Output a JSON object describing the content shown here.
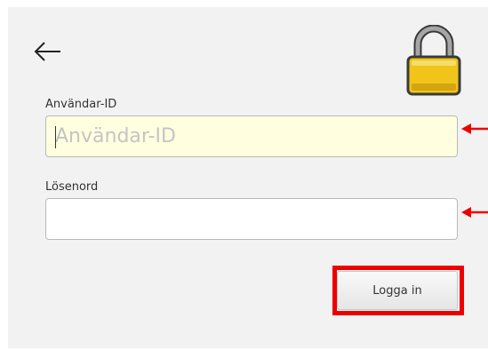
{
  "header": {
    "back_icon": "arrow-left-icon",
    "lock_icon": "padlock-icon"
  },
  "form": {
    "user_id": {
      "label": "Användar-ID",
      "placeholder": "Användar-ID",
      "value": ""
    },
    "password": {
      "label": "Lösenord",
      "placeholder": "",
      "value": ""
    },
    "login_label": "Logga in"
  },
  "annotations": {
    "arrow_icon": "red-arrow-left-icon",
    "color": "#ee0000"
  },
  "colors": {
    "panel_bg": "#f2f2f2",
    "autofill_bg": "#ffffe0",
    "lock_body": "#f0c419",
    "lock_shackle": "#9a9a9a"
  }
}
